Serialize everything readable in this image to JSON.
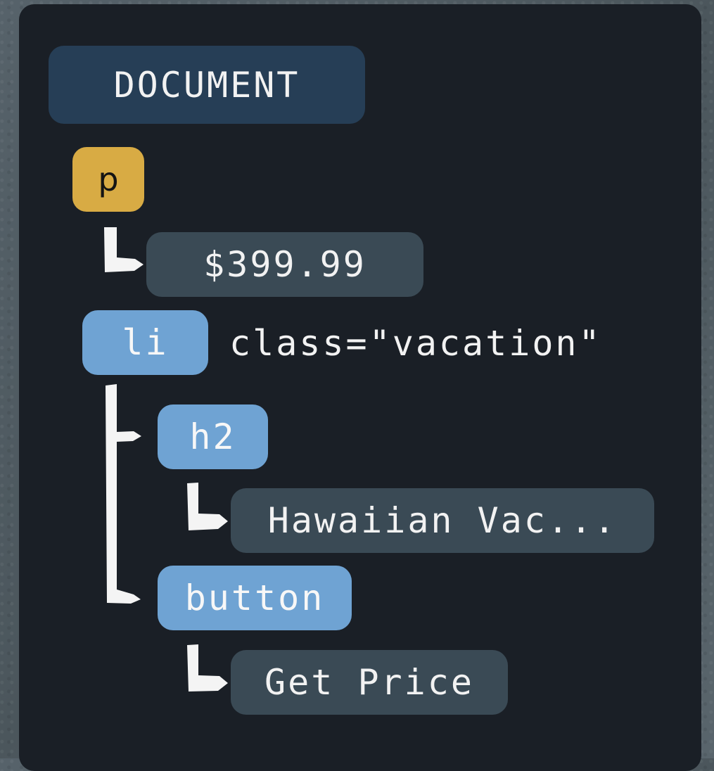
{
  "tree": {
    "root_label": "DOCUMENT",
    "nodes": {
      "p": {
        "tag": "p",
        "color": "#d8ab44"
      },
      "p_text": {
        "text": "$399.99"
      },
      "li": {
        "tag": "li",
        "attribute": "class=\"vacation\"",
        "color": "#6fa3d3"
      },
      "h2": {
        "tag": "h2"
      },
      "h2_text": {
        "text": "Hawaiian Vac..."
      },
      "button": {
        "tag": "button"
      },
      "button_text": {
        "text": "Get Price"
      }
    },
    "colors": {
      "panel": "#1a1f26",
      "root": "#263e56",
      "text_node": "#3a4a55",
      "element_node": "#6fa3d3",
      "highlight_node": "#d8ab44",
      "connector": "#ffffff"
    }
  }
}
